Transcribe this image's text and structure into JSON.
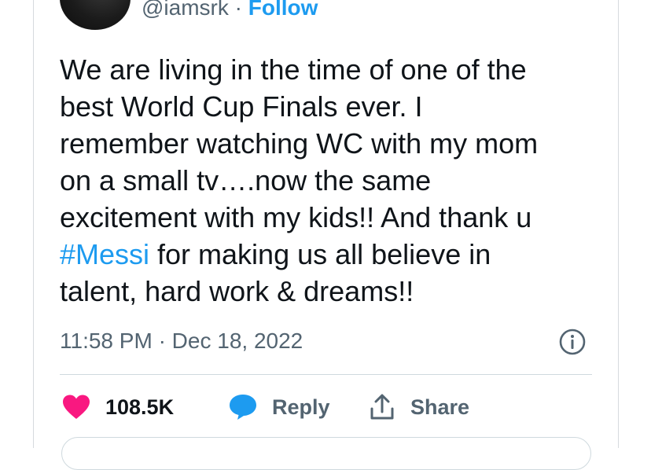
{
  "tweet": {
    "handle": "@iamsrk",
    "separator": "·",
    "follow_label": "Follow",
    "text_lines": [
      "We are living in the time of one of the",
      "best World Cup Finals ever. I",
      "remember watching WC with my mom",
      "on a small tv….now the same",
      "excitement with my kids!! And thank u"
    ],
    "hashtag": "#Messi",
    "text_after_hashtag": " for making us all believe in",
    "text_last_line": "talent, hard work & dreams!!",
    "time": "11:58 PM",
    "date_separator": "·",
    "date": "Dec 18, 2022"
  },
  "actions": {
    "like_count": "108.5K",
    "reply_label": "Reply",
    "share_label": "Share"
  },
  "colors": {
    "accent": "#1d9bf0",
    "like": "#f91880",
    "secondary_text": "#536471"
  },
  "icons": {
    "info": "info-icon",
    "like": "heart-icon",
    "reply": "speech-bubble-icon",
    "share": "share-icon"
  }
}
